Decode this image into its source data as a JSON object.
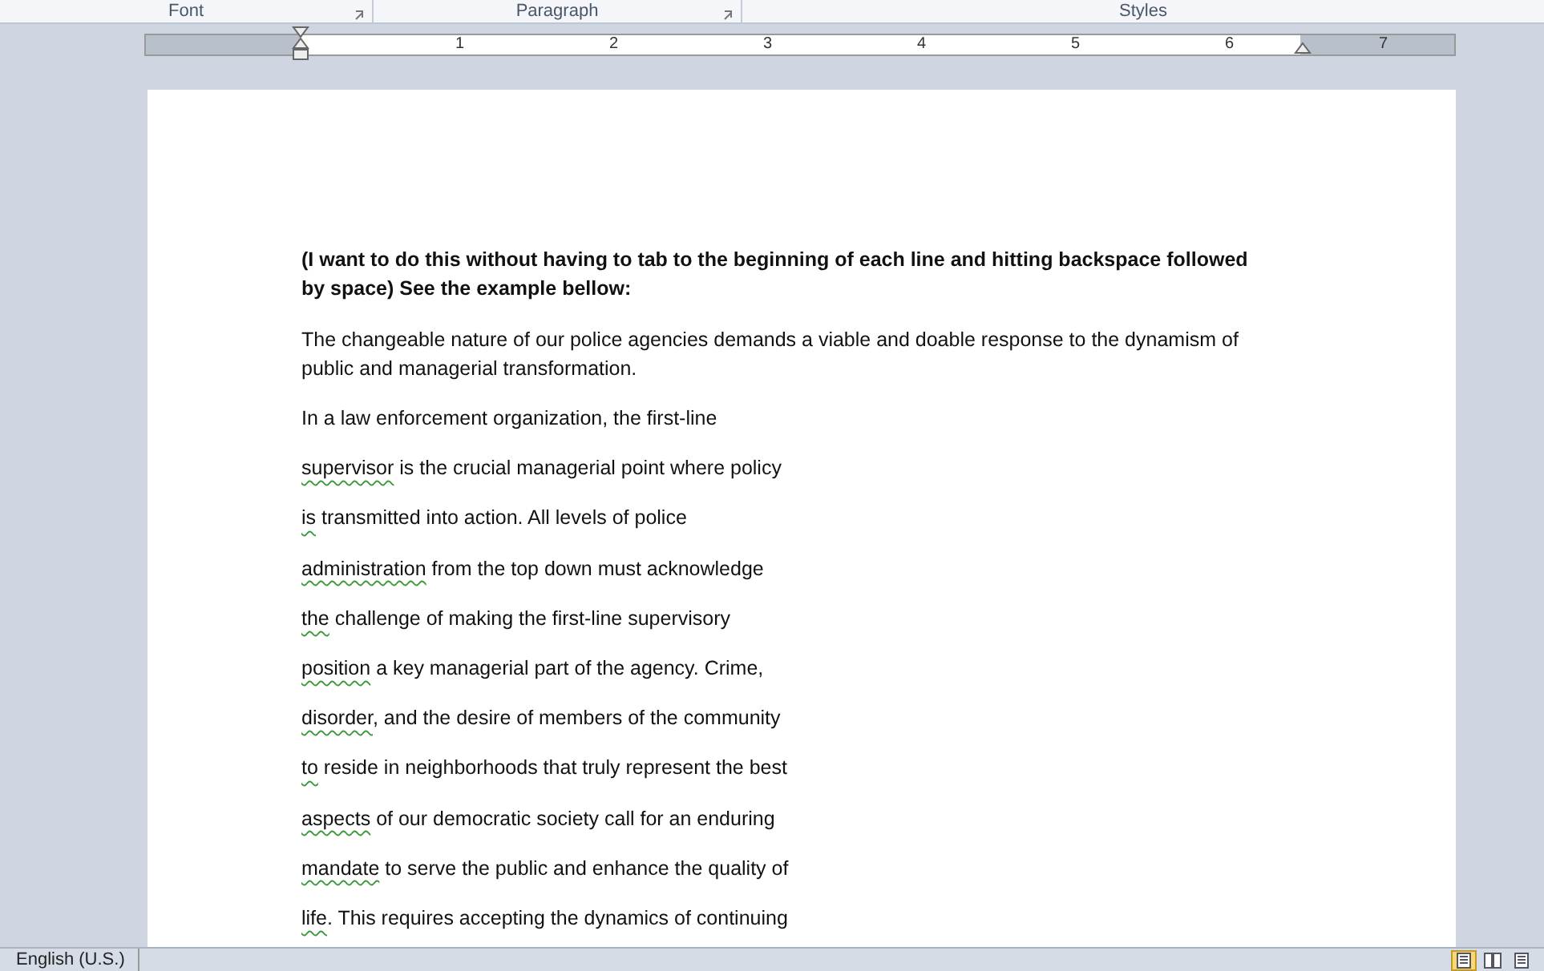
{
  "ribbon_groups": [
    {
      "label": "Font"
    },
    {
      "label": "Paragraph"
    },
    {
      "label": "Styles"
    }
  ],
  "ruler": {
    "numbers": [
      "1",
      "2",
      "3",
      "4",
      "5",
      "6",
      "7"
    ]
  },
  "document": {
    "heading": "(I want to do this without having to tab to the beginning of each line and hitting backspace followed by space) See the example bellow:",
    "paragraph": "The changeable nature of our police agencies demands a viable and doable response to the dynamism of public and managerial transformation.",
    "lines": [
      {
        "text": "In a law enforcement organization, the first-line"
      },
      {
        "flagged": "supervisor",
        "text": " is the crucial managerial point where policy"
      },
      {
        "flagged": "is",
        "text": " transmitted into action. All levels of police"
      },
      {
        "flagged": "administration",
        "text": " from the top down must acknowledge"
      },
      {
        "flagged": "the",
        "text": " challenge of making the first-line supervisory"
      },
      {
        "flagged": "position",
        "text": " a key managerial part of the agency. Crime,"
      },
      {
        "flagged": "disorder",
        "text": ", and the desire of members of the community"
      },
      {
        "flagged": "to",
        "text": " reside in neighborhoods that truly represent the best"
      },
      {
        "flagged": "aspects",
        "text": " of our democratic society call  for an enduring"
      },
      {
        "flagged": "mandate",
        "text": " to serve the public and enhance the quality of"
      },
      {
        "flagged": "life",
        "text": ". This requires accepting the dynamics of continuing"
      }
    ]
  },
  "status_bar": {
    "language": "English (U.S.)",
    "views": [
      {
        "selected": true
      },
      {
        "selected": false
      },
      {
        "selected": false
      }
    ]
  }
}
